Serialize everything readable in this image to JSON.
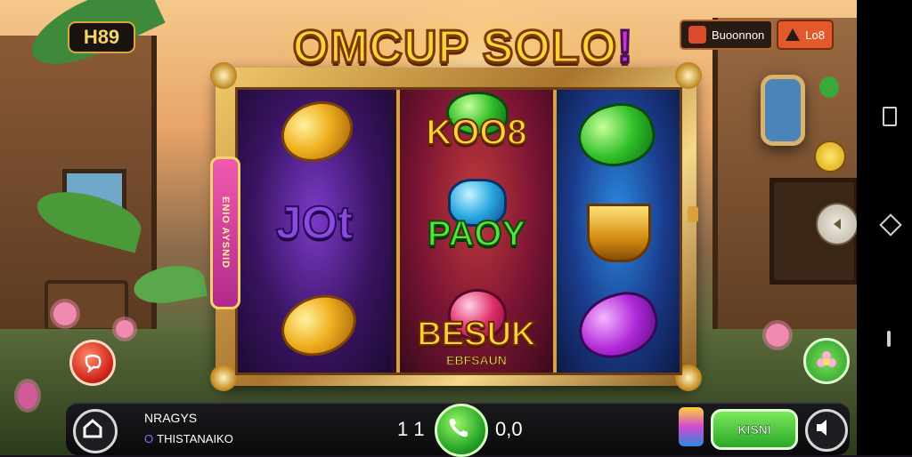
{
  "game": {
    "badge": "H89",
    "title_main": "OMCUP SOLO",
    "title_end": "!",
    "side_tab": "ENIO AYSNID"
  },
  "top_right": {
    "account_label": "Buoonnon",
    "alert_label": "Lo8"
  },
  "reels": {
    "reel1": {
      "mid_word": "JOt"
    },
    "reel2": {
      "top_word": "KOO8",
      "mid_word": "PAOY",
      "bot_word": "BESUK",
      "bot_sub": "EBFSAUN"
    }
  },
  "bottom_bar": {
    "player_name": "NRAGYS",
    "player_status_dot": "O",
    "player_status": "THISTANAIKO",
    "left_number": "1 1",
    "right_number": "0,0",
    "confirm_label": "KISNI"
  },
  "colors": {
    "title": "#ffd23a",
    "spin": "#2aa82a",
    "confirm": "#2aa82a",
    "alert": "#e25a2a"
  },
  "icons": [
    "home-icon",
    "phone-icon",
    "speaker-icon",
    "back-icon",
    "square-recent-icon",
    "diamond-rotate-icon",
    "nav-bar-icon"
  ]
}
